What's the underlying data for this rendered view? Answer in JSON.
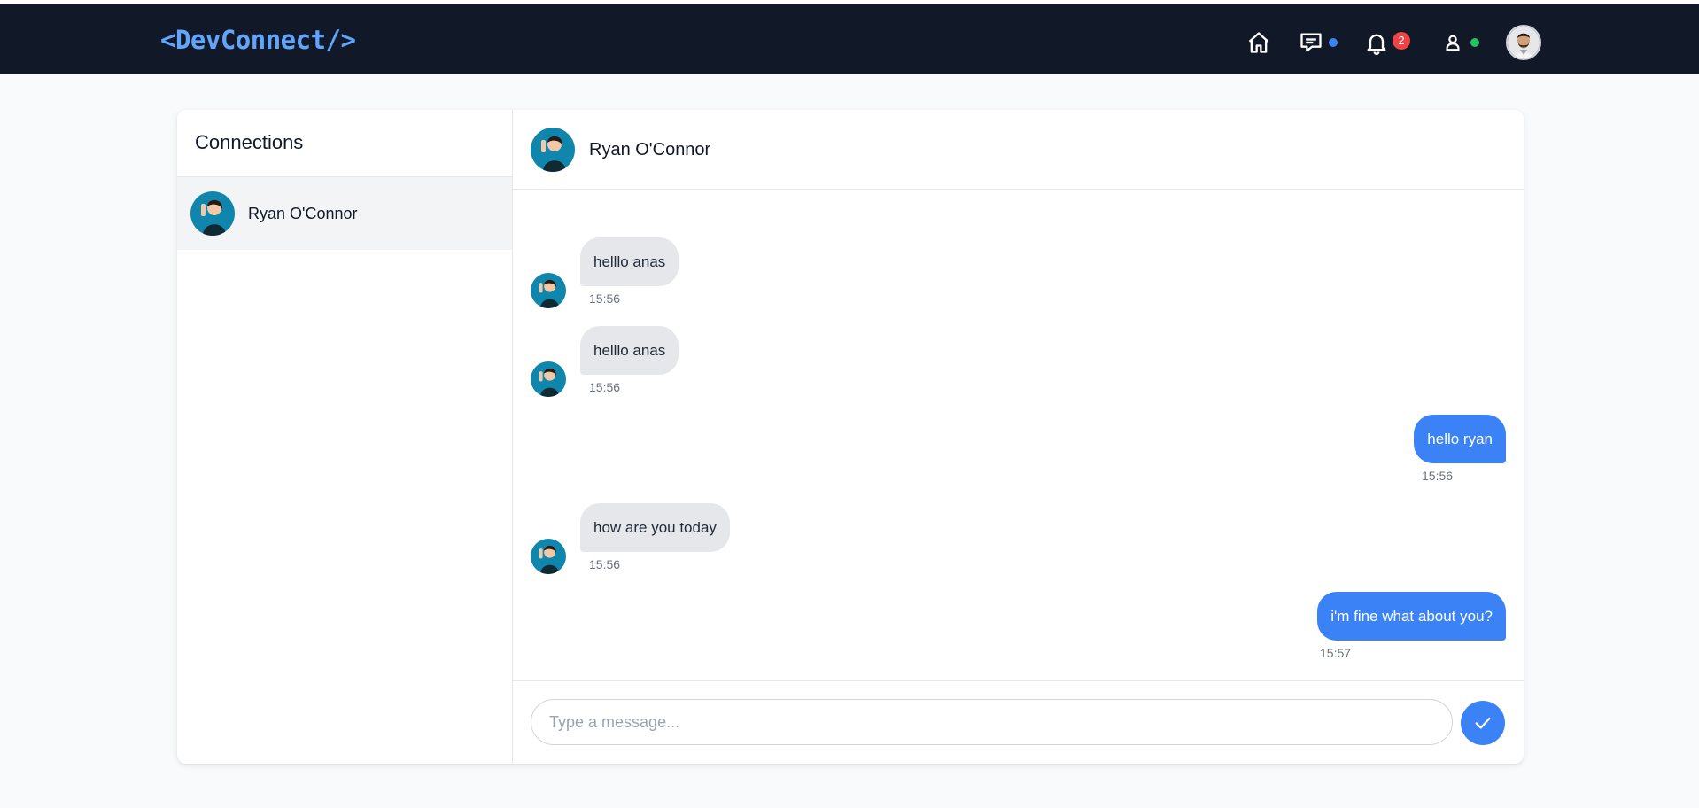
{
  "navbar": {
    "logo": "<DevConnect/>",
    "notifications_count": "2",
    "icons": [
      "home-icon",
      "messages-icon",
      "bell-icon",
      "user-icon"
    ],
    "messages_dot_color": "#3b82f6",
    "user_dot_color": "#22c55e"
  },
  "sidebar": {
    "title": "Connections",
    "connections": [
      {
        "name": "Ryan O'Connor"
      }
    ]
  },
  "chat": {
    "contact_name": "Ryan O'Connor",
    "messages": [
      {
        "direction": "in",
        "text": "helllo anas",
        "time": "15:56"
      },
      {
        "direction": "in",
        "text": "helllo anas",
        "time": "15:56"
      },
      {
        "direction": "out",
        "text": "hello ryan",
        "time": "15:56"
      },
      {
        "direction": "in",
        "text": "how are you today",
        "time": "15:56"
      },
      {
        "direction": "out",
        "text": "i'm fine what about you?",
        "time": "15:57"
      }
    ],
    "input_placeholder": "Type a message...",
    "input_value": ""
  },
  "colors": {
    "navbar_bg": "#111827",
    "logo": "#60a5fa",
    "accent": "#3b82f6",
    "incoming_bubble": "#e5e7eb",
    "badge": "#ef4444"
  }
}
